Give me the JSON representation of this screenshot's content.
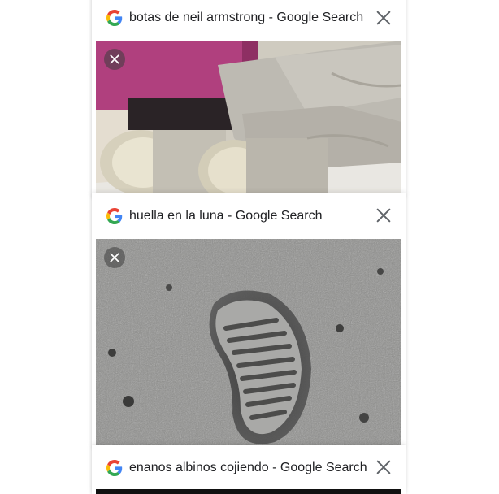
{
  "tabs": [
    {
      "title": "botas de neil armstrong - Google Search",
      "favicon": "google-g-icon",
      "close_icon": "close-icon",
      "thumbnail_close_icon": "close-icon"
    },
    {
      "title": "huella en la luna - Google Search",
      "favicon": "google-g-icon",
      "close_icon": "close-icon",
      "thumbnail_close_icon": "close-icon"
    },
    {
      "title": "enanos albinos cojiendo - Google Search",
      "favicon": "google-g-icon",
      "close_icon": "close-icon"
    }
  ],
  "colors": {
    "google_blue": "#4285F4",
    "google_red": "#EA4335",
    "google_yellow": "#FBBC05",
    "google_green": "#34A853",
    "title_text": "#202124",
    "close_icon": "#5f6368"
  }
}
